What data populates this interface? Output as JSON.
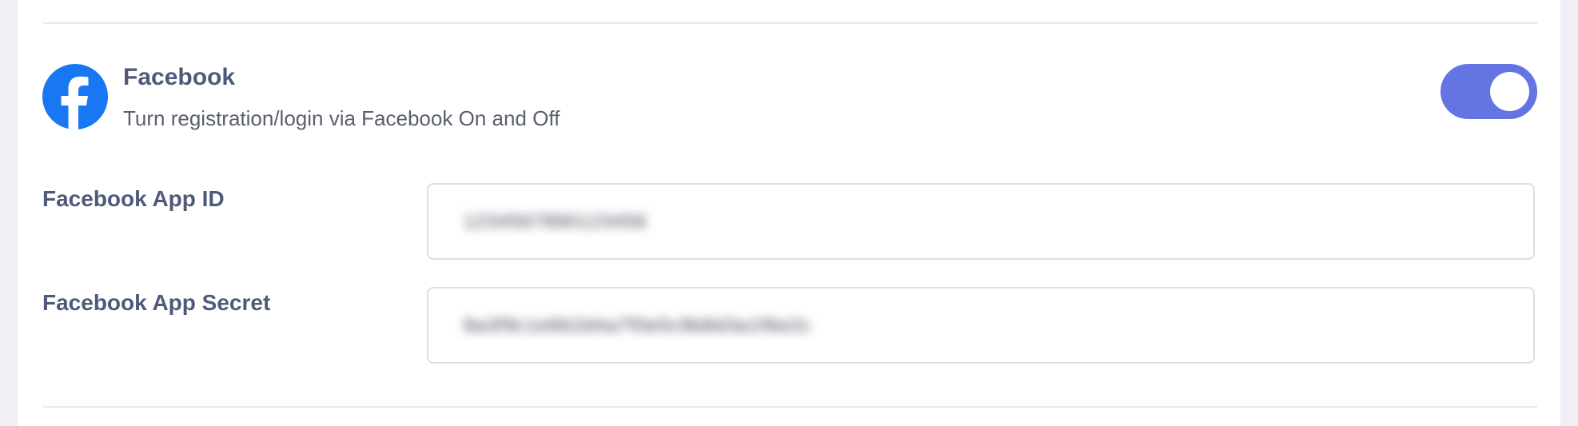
{
  "provider": {
    "name": "Facebook",
    "description": "Turn registration/login via Facebook On and Off",
    "icon": "facebook-icon",
    "brand_color": "#1877f2",
    "enabled": true,
    "toggle_color": "#6474e2"
  },
  "fields": {
    "app_id": {
      "label": "Facebook App ID",
      "value": "1234567890123456"
    },
    "app_secret": {
      "label": "Facebook App Secret",
      "value": "8a3f9c1e6b2d4a7f0e5c9b8d3a1f6e2c"
    }
  }
}
